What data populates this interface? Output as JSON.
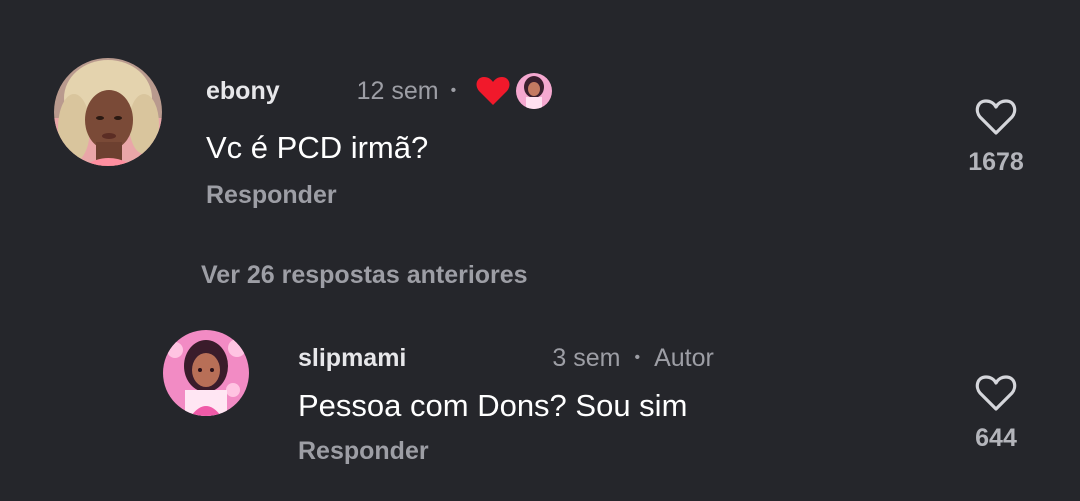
{
  "comments": [
    {
      "username": "ebony",
      "time": "12 sem",
      "separator": "•",
      "text": "Vc é PCD irmã?",
      "reply_label": "Responder",
      "like_count": "1678",
      "avatar_icon": "user-avatar-photo",
      "liked_by_author_icon": "heart-icon",
      "heart_color": "#f1192b"
    },
    {
      "username": "slipmami",
      "time": "3 sem",
      "separator": "•",
      "author_tag": "Autor",
      "text": "Pessoa com Dons? Sou sim",
      "reply_label": "Responder",
      "like_count": "644",
      "avatar_icon": "author-avatar-illustration"
    }
  ],
  "view_more_replies": "Ver 26 respostas anteriores",
  "colors": {
    "background": "#25262b",
    "secondary_text": "#9d9ea5",
    "accent_pink": "#f05aa8"
  }
}
